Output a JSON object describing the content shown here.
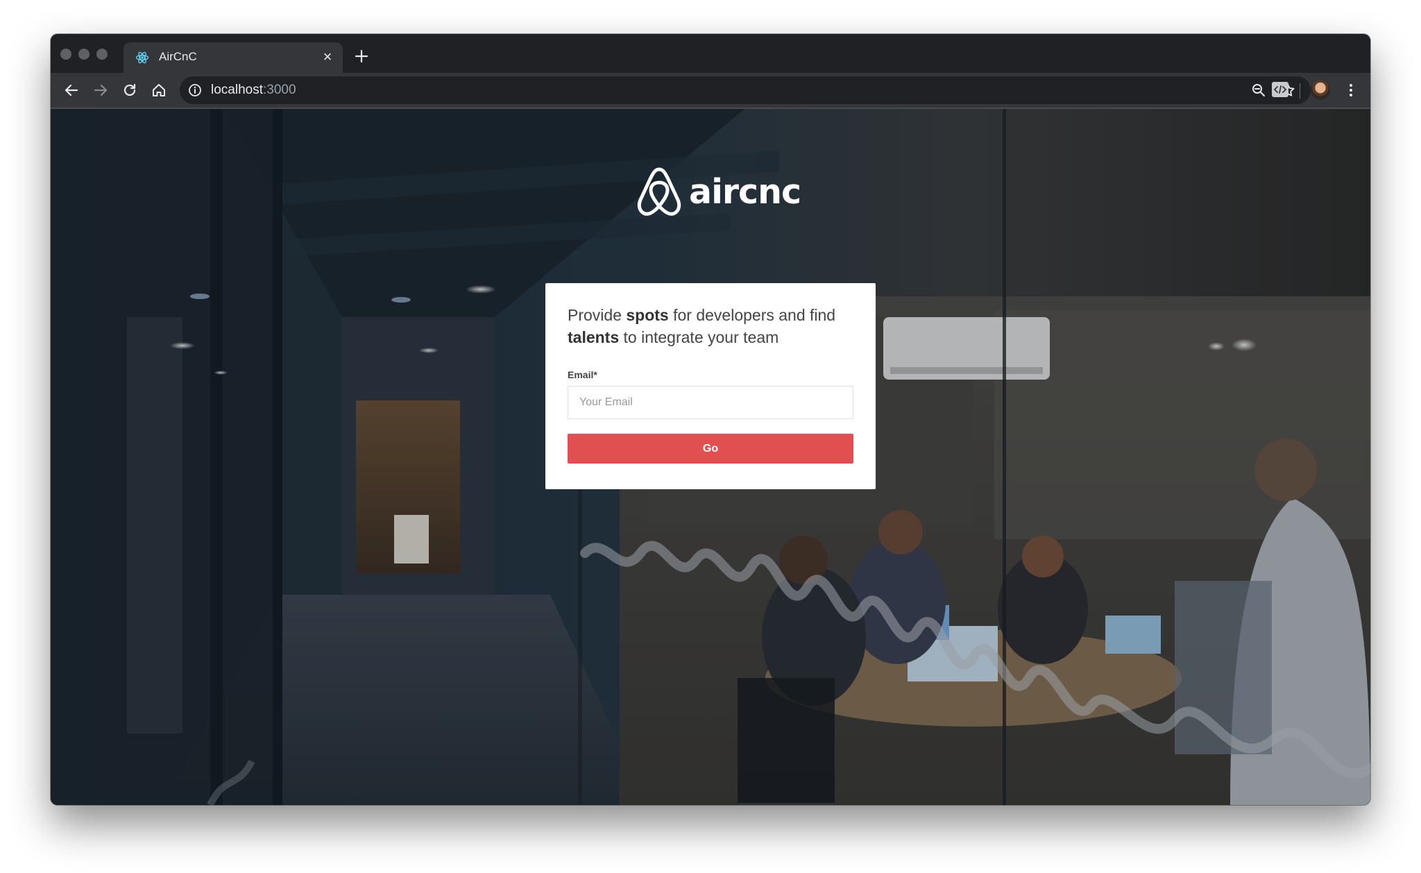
{
  "browser": {
    "tab": {
      "title": "AirCnC",
      "favicon": "react-atom-icon"
    },
    "address_bar": {
      "host": "localhost",
      "port": ":3000"
    },
    "toolbar_icons": [
      "back-arrow-icon",
      "forward-arrow-icon",
      "reload-icon",
      "home-icon",
      "site-info-icon",
      "zoom-icon",
      "star-bookmark-icon",
      "extension-icon",
      "avatar",
      "more-menu-icon"
    ]
  },
  "page": {
    "logo": {
      "wordmark": "aircnc",
      "symbol": "airbnb-belo-icon"
    },
    "tagline": {
      "part1": "Provide ",
      "bold1": "spots",
      "part2": " for developers and find ",
      "bold2": "talents",
      "part3": " to integrate your team"
    },
    "form": {
      "email_label": "Email*",
      "email_placeholder": "Your Email",
      "email_value": "",
      "submit_label": "Go"
    }
  },
  "colors": {
    "accent": "#e14f50",
    "chrome_dark": "#202124",
    "chrome_toolbar": "#35363a"
  }
}
